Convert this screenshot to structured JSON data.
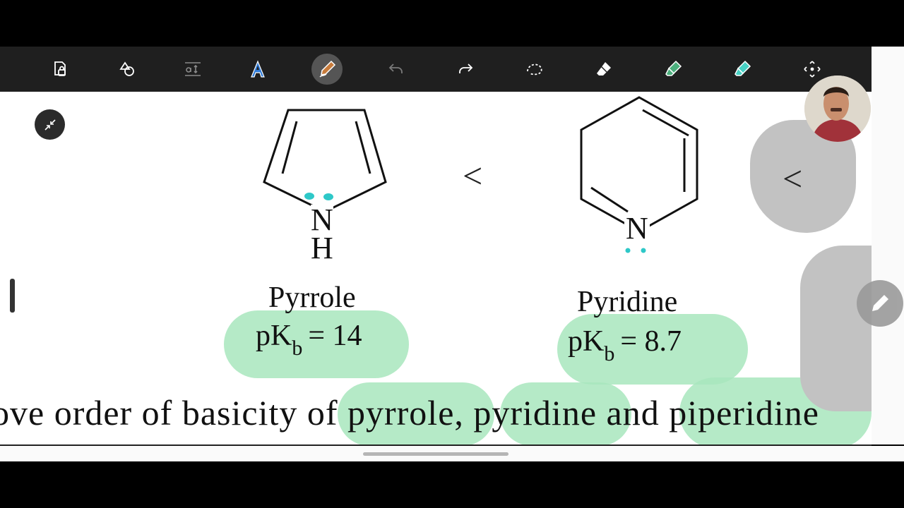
{
  "toolbar": {
    "tools": [
      {
        "icon": "page-lock-icon"
      },
      {
        "icon": "shapes-icon"
      },
      {
        "icon": "text-tool-icon",
        "glyph": "a‡"
      },
      {
        "icon": "text-style-icon",
        "glyph": "A"
      },
      {
        "icon": "pen-icon",
        "active": true
      },
      {
        "icon": "undo-icon"
      },
      {
        "icon": "redo-icon"
      },
      {
        "icon": "lasso-icon"
      },
      {
        "icon": "eraser-icon"
      },
      {
        "icon": "highlighter-icon"
      },
      {
        "icon": "marker-icon"
      },
      {
        "icon": "move-icon"
      }
    ]
  },
  "document": {
    "pyrrole": {
      "atom_n": "N",
      "atom_h": "H",
      "name": "Pyrrole",
      "pkb_prefix": "pK",
      "pkb_sub": "b",
      "pkb_value": "= 14"
    },
    "pyridine": {
      "atom_n": "N",
      "name": "Pyridine",
      "pkb_prefix": "pK",
      "pkb_sub": "b",
      "pkb_value": "= 8.7"
    },
    "comparator_1": "<",
    "comparator_2": "<",
    "sentence": "ove order of basicity of pyrrole, pyridine and piperidine"
  },
  "colors": {
    "toolbar_bg": "#1f1f1f",
    "highlight_green": "#a8e6bd",
    "annotation_cyan": "#2ec8c8",
    "pen_brown": "#c77b3c",
    "marker_green": "#4caf7d",
    "marker_teal": "#48d1c4"
  }
}
